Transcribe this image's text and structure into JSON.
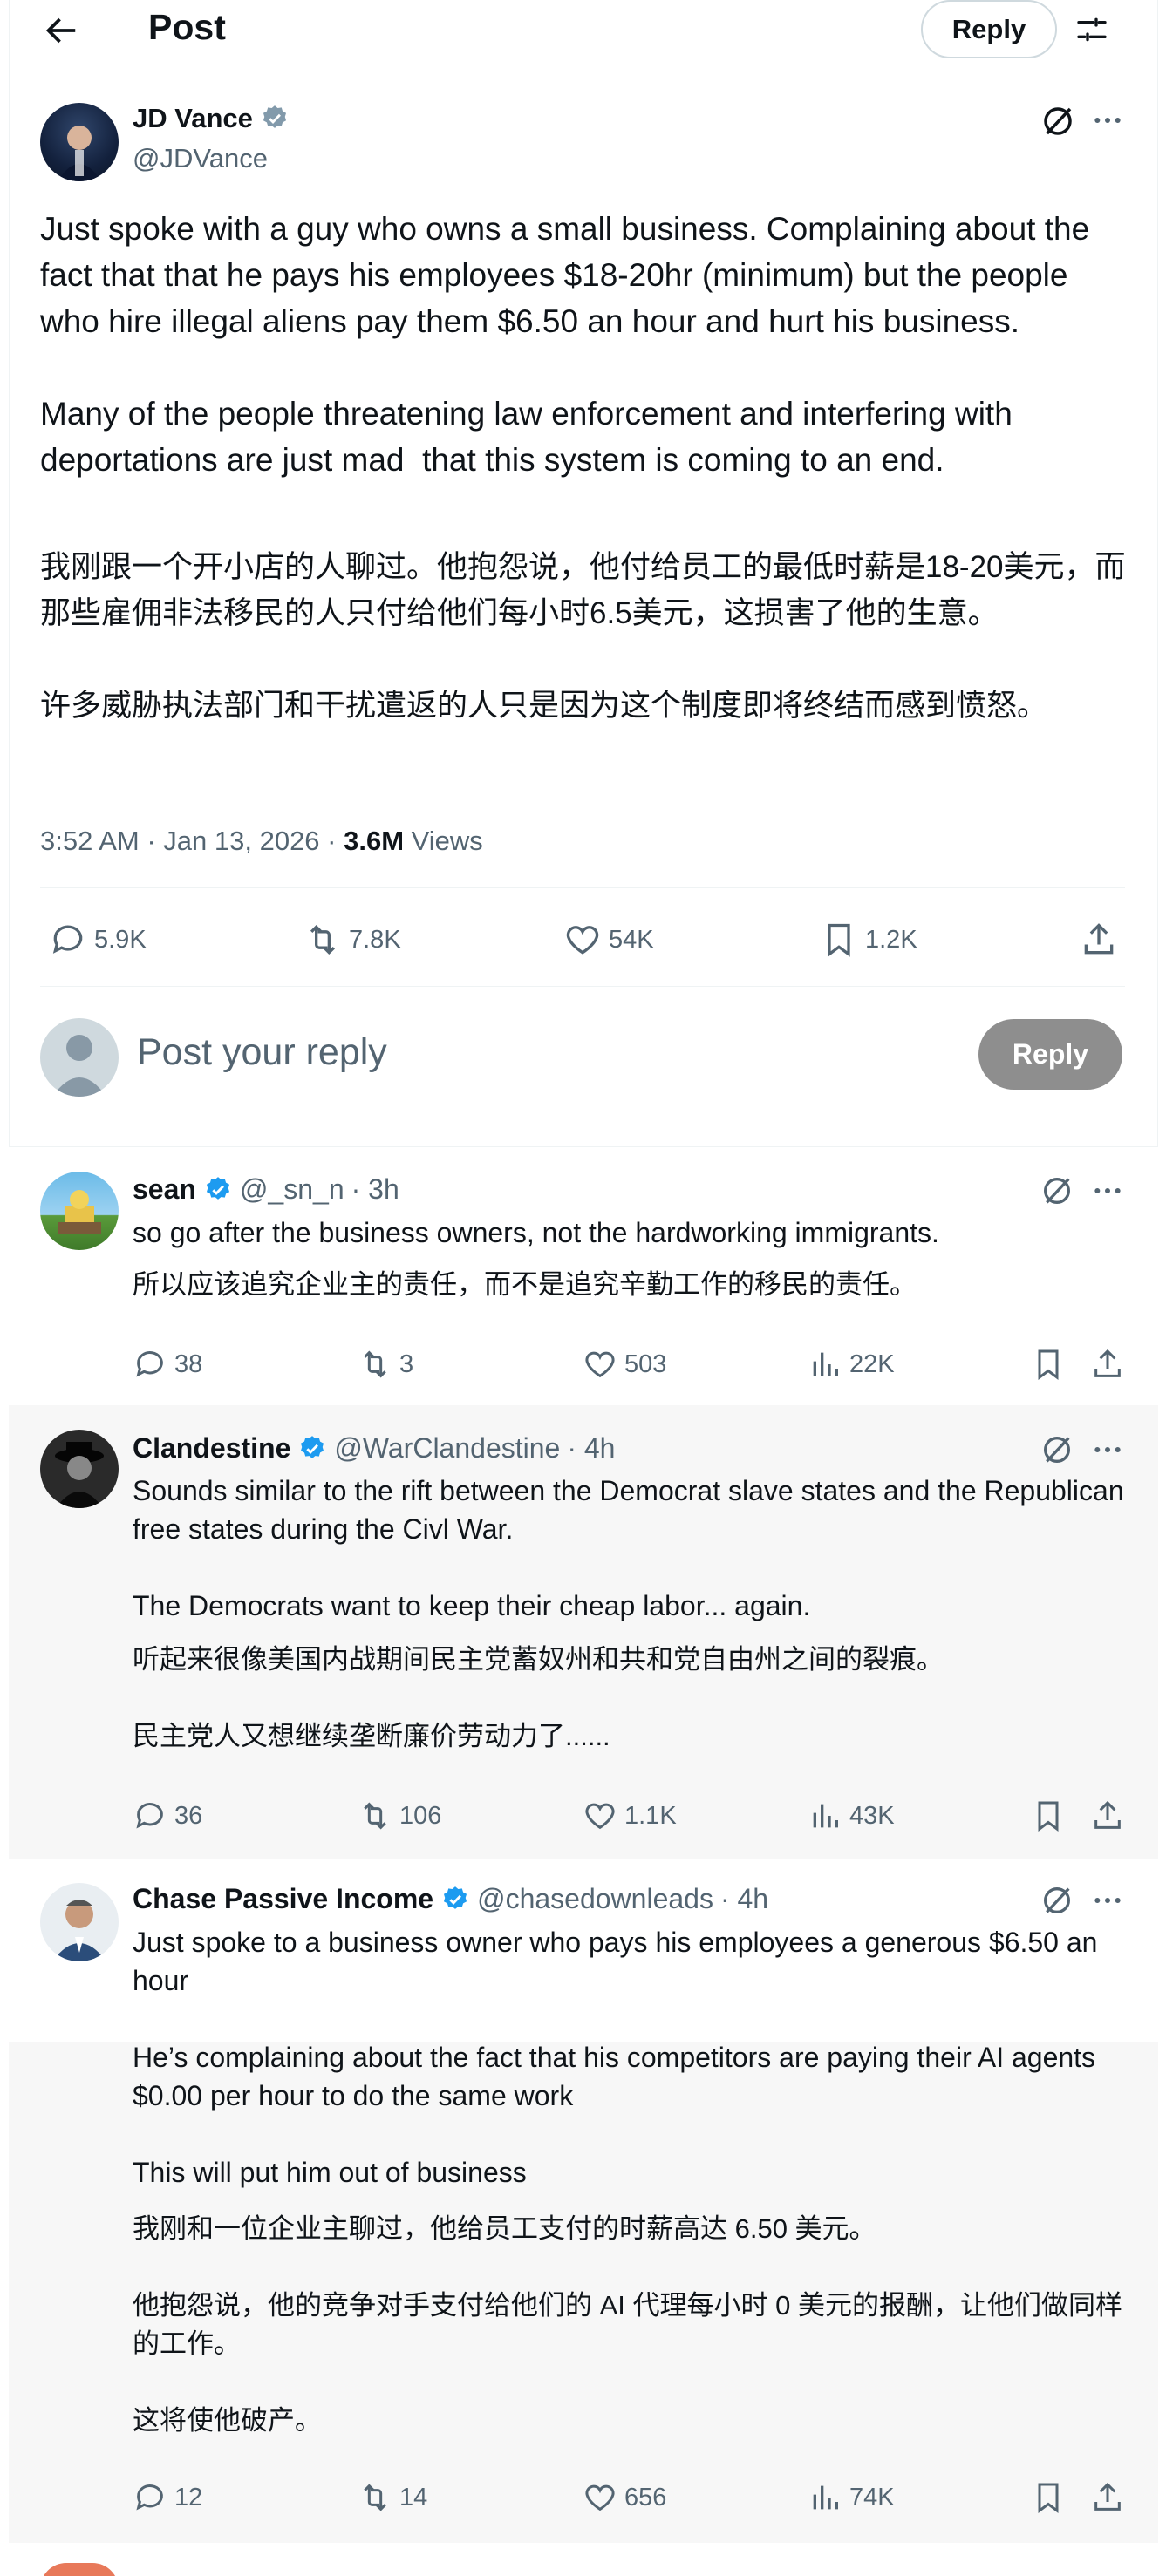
{
  "header": {
    "title": "Post",
    "reply_label": "Reply"
  },
  "main_post": {
    "name": "JD Vance",
    "handle": "@JDVance",
    "text_en": "Just spoke with a guy who owns a small business. Complaining about the fact that that he pays his employees $18-20hr (minimum) but the people who hire illegal aliens pay them $6.50 an hour and hurt his business.\n\nMany of the people threatening law enforcement and interfering with deportations are just mad  that this system is coming to an end.",
    "text_cn": "我刚跟一个开小店的人聊过。他抱怨说，他付给员工的最低时薪是18-20美元，而那些雇佣非法移民的人只付给他们每小时6.5美元，这损害了他的生意。\n\n许多威胁执法部门和干扰遣返的人只是因为这个制度即将终结而感到愤怒。",
    "timestamp": "3:52 AM · Jan 13, 2026 · ",
    "views_count": "3.6M",
    "views_label": " Views",
    "replies": "5.9K",
    "reposts": "7.8K",
    "likes": "54K",
    "bookmarks": "1.2K"
  },
  "reply_box": {
    "placeholder": "Post your reply",
    "button_label": "Reply"
  },
  "replies": [
    {
      "name": "sean",
      "handle": "@_sn_n",
      "time": "· 3h",
      "text_en": "so go after the business owners, not the hardworking immigrants.",
      "text_cn": "所以应该追究企业主的责任，而不是追究辛勤工作的移民的责任。",
      "replies": "38",
      "reposts": "3",
      "likes": "503",
      "views": "22K"
    },
    {
      "name": "Clandestine",
      "handle": "@WarClandestine",
      "time": "· 4h",
      "text_en": "Sounds similar to the rift between the Democrat slave states and the Republican free states during the Civl War.\n\nThe Democrats want to keep their cheap labor... again.",
      "text_cn": "听起来很像美国内战期间民主党蓄奴州和共和党自由州之间的裂痕。\n\n民主党人又想继续垄断廉价劳动力了......",
      "replies": "36",
      "reposts": "106",
      "likes": "1.1K",
      "views": "43K"
    },
    {
      "name": "Chase Passive Income",
      "handle": "@chasedownleads",
      "time": "· 4h",
      "text_en_a": "Just spoke to a business owner who pays his employees a generous $6.50 an hour",
      "text_en_b": "He’s complaining about the fact that his competitors are paying their AI agents $0.00 per hour to do the same work\n\nThis will put him out of business",
      "text_cn": "我刚和一位企业主聊过，他给员工支付的时薪高达 6.50 美元。\n\n他抱怨说，他的竞争对手支付给他们的 AI 代理每小时 0 美元的报酬，让他们做同样的工作。\n\n这将使他破产。",
      "replies": "12",
      "reposts": "14",
      "likes": "656",
      "views": "74K"
    }
  ],
  "colors": {
    "accent": "#1d9bf0",
    "muted": "#536471",
    "verified_gray": "#829aab"
  },
  "icons": [
    "back-arrow-icon",
    "filter-icon",
    "grok-icon",
    "more-icon",
    "reply-icon",
    "repost-icon",
    "like-icon",
    "bookmark-icon",
    "share-icon",
    "views-icon",
    "verified-icon"
  ]
}
